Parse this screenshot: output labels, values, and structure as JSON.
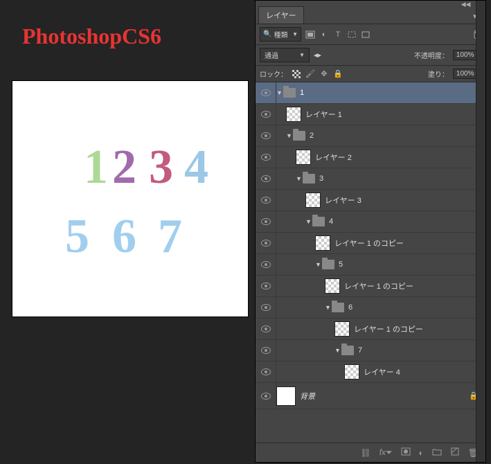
{
  "title": "PhotoshopCS6",
  "canvas": {
    "d1": "1",
    "d2": "2",
    "d3": "3",
    "d4": "4",
    "d5": "5",
    "d6": "6",
    "d7": "7"
  },
  "panel": {
    "tab": "レイヤー",
    "filter": "種類",
    "blend_mode": "通過",
    "opacity_label": "不透明度：",
    "opacity_value": "100%",
    "lock_label": "ロック：",
    "fill_label": "塗り：",
    "fill_value": "100%"
  },
  "layers": [
    {
      "type": "group",
      "name": "1",
      "depth": 0,
      "selected": true
    },
    {
      "type": "layer",
      "name": "レイヤー 1",
      "depth": 1
    },
    {
      "type": "group",
      "name": "2",
      "depth": 1
    },
    {
      "type": "layer",
      "name": "レイヤー 2",
      "depth": 2
    },
    {
      "type": "group",
      "name": "3",
      "depth": 2
    },
    {
      "type": "layer",
      "name": "レイヤー 3",
      "depth": 3
    },
    {
      "type": "group",
      "name": "4",
      "depth": 3
    },
    {
      "type": "layer",
      "name": "レイヤー 1 のコピー",
      "depth": 4
    },
    {
      "type": "group",
      "name": "5",
      "depth": 4
    },
    {
      "type": "layer",
      "name": "レイヤー 1 のコピー",
      "depth": 5
    },
    {
      "type": "group",
      "name": "6",
      "depth": 5
    },
    {
      "type": "layer",
      "name": "レイヤー 1 のコピー",
      "depth": 6
    },
    {
      "type": "group",
      "name": "7",
      "depth": 6
    },
    {
      "type": "layer",
      "name": "レイヤー 4",
      "depth": 7
    },
    {
      "type": "bg",
      "name": "背景",
      "depth": 0,
      "locked": true
    }
  ]
}
